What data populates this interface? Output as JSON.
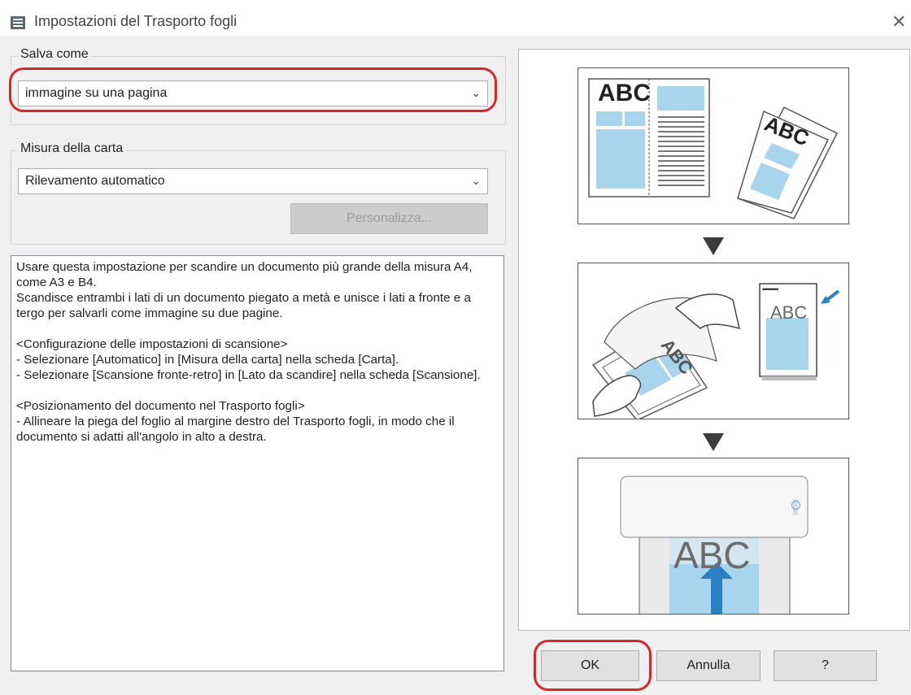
{
  "window": {
    "title": "Impostazioni del Trasporto fogli",
    "close_glyph": "✕"
  },
  "save_as": {
    "label": "Salva come",
    "value": "immagine su una pagina"
  },
  "paper_size": {
    "label": "Misura della carta",
    "value": "Rilevamento automatico",
    "customize_label": "Personalizza..."
  },
  "description": "Usare questa impostazione per scandire un documento più grande della misura A4, come A3 e B4.\nScandisce entrambi i lati di un documento piegato a metà e unisce i lati a fronte e a tergo per salvarli come immagine su due pagine.\n\n<Configurazione delle impostazioni di scansione>\n- Selezionare [Automatico] in [Misura della carta] nella scheda [Carta].\n- Selezionare [Scansione fronte-retro] in [Lato da scandire] nella scheda [Scansione].\n\n<Posizionamento del documento nel Trasporto fogli>\n- Allineare la piega del foglio al margine destro del Trasporto fogli, in modo che il documento si adatti all'angolo in alto a destra.",
  "illustration": {
    "abc": "ABC",
    "dots": "•••••••••"
  },
  "buttons": {
    "ok": "OK",
    "cancel": "Annulla",
    "help": "?"
  },
  "colors": {
    "highlight": "#d7272b",
    "illustration_blue": "#a9d4ee",
    "arrow_blue": "#2a7fc5"
  }
}
